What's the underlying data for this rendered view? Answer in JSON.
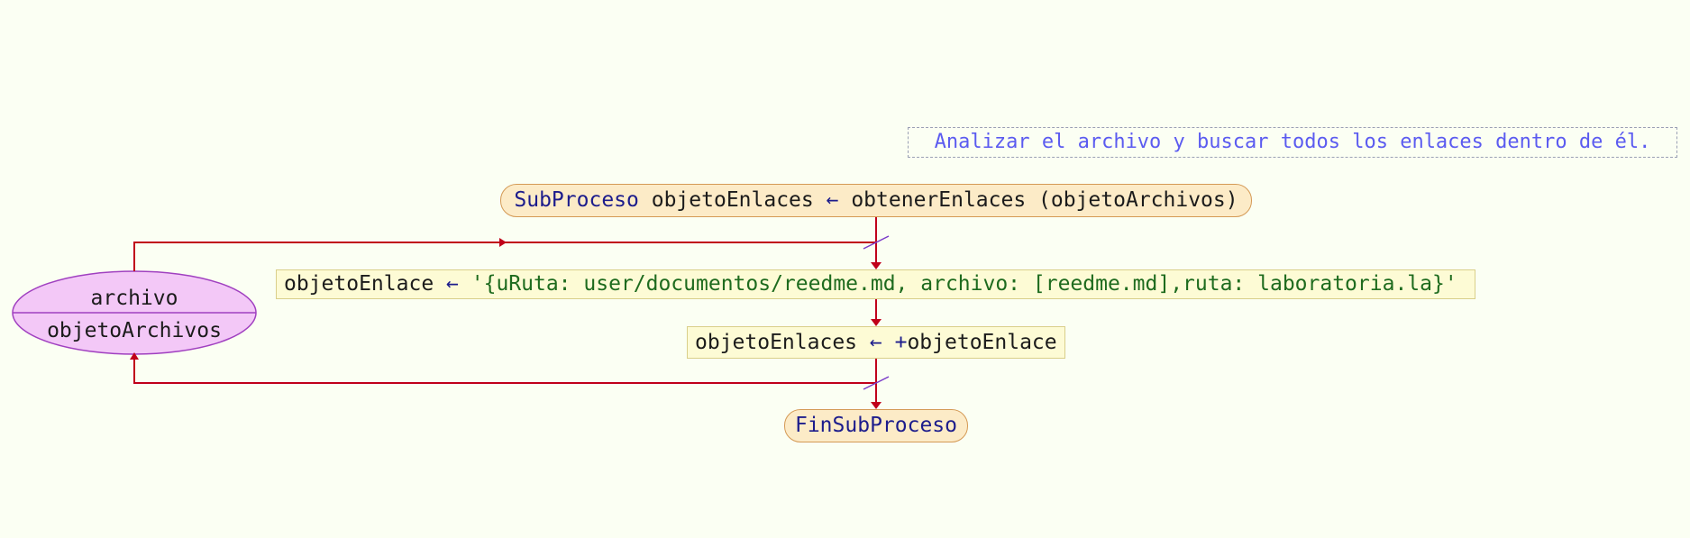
{
  "colors": {
    "background": "#fbfff3",
    "arrow": "#c0001a",
    "comment_text": "#5b5bf0",
    "keyword": "#1c1c8c",
    "string": "#1e6b1e",
    "terminal_fill": "#fcebc7",
    "process_fill": "#fdfbd5",
    "ellipse_fill": "#f3c8f7",
    "ellipse_border": "#a040c0",
    "cut_mark": "#7a3cc8"
  },
  "comment": "Analizar el archivo y buscar todos los enlaces dentro de él.",
  "start": {
    "keyword": "SubProceso",
    "target": "objetoEnlaces",
    "arrow": "←",
    "call": "obtenerEnlaces (objetoArchivos)"
  },
  "assign1": {
    "target": "objetoEnlace",
    "arrow": "←",
    "value": "'{uRuta: user/documentos/reedme.md, archivo: [reedme.md],ruta: laboratoria.la}'"
  },
  "assign2": {
    "target": "objetoEnlaces",
    "arrow": "←",
    "op": "+",
    "value": "objetoEnlace"
  },
  "loop": {
    "top_label": "archivo",
    "bottom_label": "objetoArchivos"
  },
  "end": {
    "keyword": "FinSubProceso"
  }
}
